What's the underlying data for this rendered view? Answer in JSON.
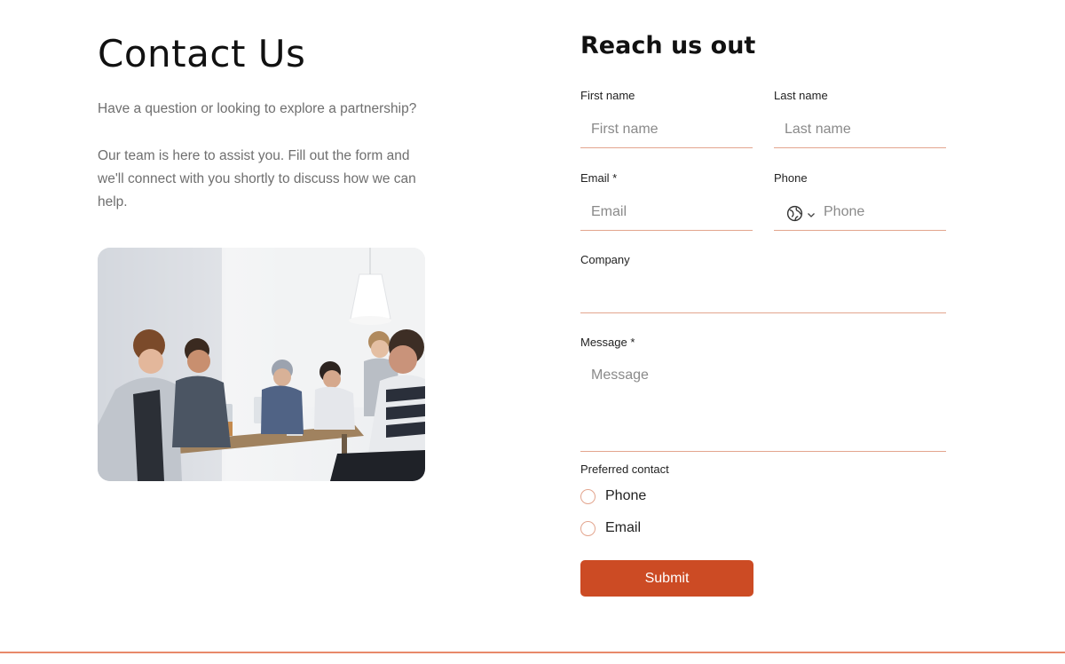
{
  "left": {
    "title": "Contact Us",
    "intro": "Have a question or looking to explore a partnership?",
    "description": "Our team is here to assist you. Fill out the form and we'll connect with you shortly to discuss how we can help."
  },
  "form": {
    "title": "Reach us out",
    "first_name": {
      "label": "First name",
      "placeholder": "First name",
      "value": ""
    },
    "last_name": {
      "label": "Last name",
      "placeholder": "Last name",
      "value": ""
    },
    "email": {
      "label": "Email *",
      "placeholder": "Email",
      "value": ""
    },
    "phone": {
      "label": "Phone",
      "placeholder": "Phone",
      "value": ""
    },
    "company": {
      "label": "Company",
      "placeholder": "",
      "value": ""
    },
    "message": {
      "label": "Message *",
      "placeholder": "Message",
      "value": ""
    },
    "preferred_contact": {
      "label": "Preferred contact",
      "options": [
        "Phone",
        "Email"
      ]
    },
    "submit_label": "Submit"
  },
  "colors": {
    "accent": "#cc4b24",
    "underline": "#e3a58e",
    "footer_rule": "#e8896a"
  },
  "icons": {
    "phone_country": "globe-icon",
    "phone_dropdown": "chevron-down-icon"
  }
}
